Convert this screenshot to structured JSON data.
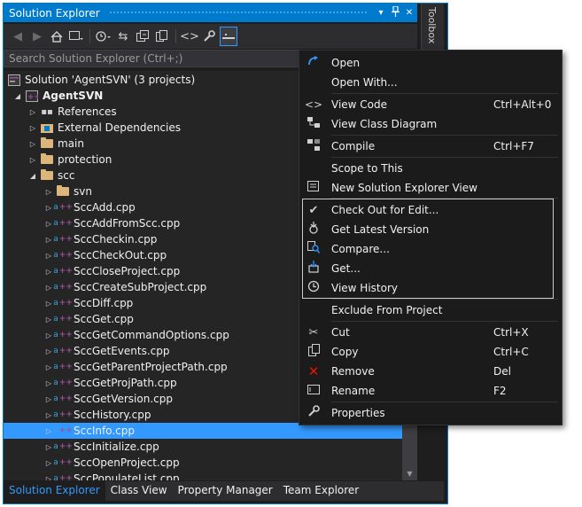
{
  "window": {
    "title": "Solution Explorer",
    "title_buttons": [
      "▾",
      "📌",
      "✕"
    ],
    "side_tab": "Toolbox"
  },
  "toolbar": {
    "buttons": [
      "back-icon",
      "forward-icon",
      "home-icon",
      "switch-views-icon",
      "pending-changes-icon",
      "sync-icon",
      "collapse-all-icon",
      "show-all-files-icon",
      "view-code-icon",
      "properties-icon",
      "preview-icon"
    ]
  },
  "search": {
    "placeholder": "Search Solution Explorer (Ctrl+;)"
  },
  "tree": {
    "solution": "Solution 'AgentSVN' (3 projects)",
    "project": "AgentSVN",
    "nodes": [
      "References",
      "External Dependencies",
      "main",
      "protection",
      "scc",
      "svn"
    ],
    "files": [
      "SccAdd.cpp",
      "SccAddFromScc.cpp",
      "SccCheckin.cpp",
      "SccCheckOut.cpp",
      "SccCloseProject.cpp",
      "SccCreateSubProject.cpp",
      "SccDiff.cpp",
      "SccGet.cpp",
      "SccGetCommandOptions.cpp",
      "SccGetEvents.cpp",
      "SccGetParentProjectPath.cpp",
      "SccGetProjPath.cpp",
      "SccGetVersion.cpp",
      "SccHistory.cpp",
      "SccInfo.cpp",
      "SccInitialize.cpp",
      "SccOpenProject.cpp",
      "SccPopulateList.cpp"
    ],
    "selected_file": "SccInfo.cpp"
  },
  "tabs": [
    "Solution Explorer",
    "Class View",
    "Property Manager",
    "Team Explorer"
  ],
  "menu": {
    "items": [
      {
        "label": "Open",
        "shortcut": "",
        "icon": "open-icon"
      },
      {
        "label": "Open With...",
        "shortcut": "",
        "icon": ""
      },
      {
        "label": "View Code",
        "shortcut": "Ctrl+Alt+0",
        "icon": "view-code-icon"
      },
      {
        "label": "View Class Diagram",
        "shortcut": "",
        "icon": "class-diagram-icon"
      },
      {
        "label": "Compile",
        "shortcut": "Ctrl+F7",
        "icon": "compile-icon"
      },
      {
        "label": "Scope to This",
        "shortcut": "",
        "icon": ""
      },
      {
        "label": "New Solution Explorer View",
        "shortcut": "",
        "icon": "new-view-icon"
      },
      {
        "label": "Check Out for Edit...",
        "shortcut": "",
        "icon": "checkmark-icon"
      },
      {
        "label": "Get Latest Version",
        "shortcut": "",
        "icon": "get-latest-icon"
      },
      {
        "label": "Compare...",
        "shortcut": "",
        "icon": "compare-icon"
      },
      {
        "label": "Get...",
        "shortcut": "",
        "icon": "get-icon"
      },
      {
        "label": "View History",
        "shortcut": "",
        "icon": "history-icon"
      },
      {
        "label": "Exclude From Project",
        "shortcut": "",
        "icon": ""
      },
      {
        "label": "Cut",
        "shortcut": "Ctrl+X",
        "icon": "scissors-icon"
      },
      {
        "label": "Copy",
        "shortcut": "Ctrl+C",
        "icon": "copy-icon"
      },
      {
        "label": "Remove",
        "shortcut": "Del",
        "icon": "remove-icon"
      },
      {
        "label": "Rename",
        "shortcut": "F2",
        "icon": "rename-icon"
      },
      {
        "label": "Properties",
        "shortcut": "",
        "icon": "wrench-icon"
      }
    ]
  },
  "colors": {
    "accent": "#007acc",
    "selection": "#3399ff",
    "background": "#1e1e1e",
    "menu_background": "#1b1b1c",
    "remove_icon": "#e51400"
  }
}
